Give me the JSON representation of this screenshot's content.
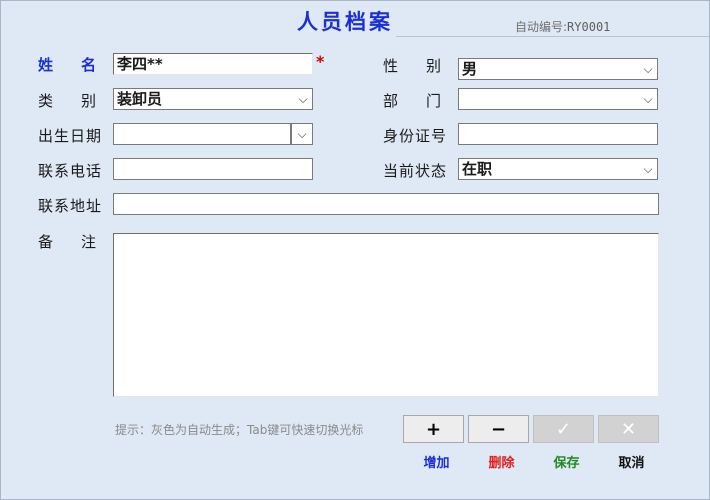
{
  "header": {
    "title": "人员档案",
    "auto_id_label": "自动编号:",
    "auto_id_value": "RY0001"
  },
  "form": {
    "name": {
      "label_a": "姓",
      "label_b": "名",
      "value": "李四**",
      "required_mark": "*"
    },
    "gender": {
      "label_a": "性",
      "label_b": "别",
      "value": "男"
    },
    "category": {
      "label_a": "类",
      "label_b": "别",
      "value": "装卸员"
    },
    "dept": {
      "label_a": "部",
      "label_b": "门",
      "value": ""
    },
    "birth": {
      "label": "出生日期",
      "value": ""
    },
    "id_no": {
      "label": "身份证号",
      "value": ""
    },
    "phone": {
      "label": "联系电话",
      "value": ""
    },
    "status": {
      "label": "当前状态",
      "value": "在职"
    },
    "address": {
      "label": "联系地址",
      "value": ""
    },
    "remark": {
      "label_a": "备",
      "label_b": "注",
      "value": ""
    }
  },
  "hint": "提示：灰色为自动生成；Tab键可快速切换光标",
  "buttons": {
    "add": {
      "symbol": "+",
      "label": "增加",
      "color": "#1b2fd6"
    },
    "delete": {
      "symbol": "−",
      "label": "删除",
      "color": "#e0201e"
    },
    "save": {
      "symbol": "✓",
      "label": "保存",
      "color": "#1f8a1f"
    },
    "cancel": {
      "symbol": "✕",
      "label": "取消",
      "color": "#111111"
    }
  },
  "icons": {
    "dropdown": "chevron-down-icon"
  }
}
